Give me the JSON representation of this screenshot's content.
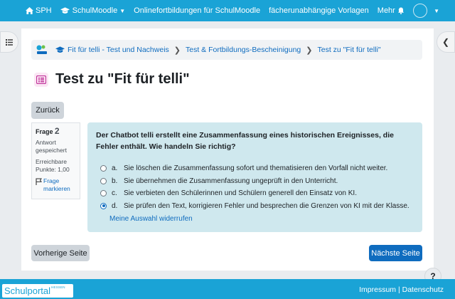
{
  "topnav": {
    "home_label": "SPH",
    "items": [
      "SchulMoodle",
      "Onlinefortbildungen für SchulMoodle",
      "fächerunabhängige Vorlagen",
      "Mehr"
    ]
  },
  "breadcrumb": [
    "Fit für telli - Test und Nachweis",
    "Test & Fortbildungs-Bescheinigung",
    "Test zu \"Fit für telli\""
  ],
  "page_title": "Test zu \"Fit für telli\"",
  "back_label": "Zurück",
  "question_info": {
    "label": "Frage",
    "number": "2",
    "state": "Antwort gespeichert",
    "points": "Erreichbare Punkte: 1,00",
    "flag": "Frage markieren"
  },
  "question": {
    "text": "Der Chatbot telli erstellt eine Zusammenfassung eines historischen Ereignisses, die Fehler enthält. Wie handeln Sie richtig?",
    "answers": [
      {
        "letter": "a.",
        "text": "Sie löschen die Zusammenfassung sofort und thematisieren den Vorfall nicht weiter.",
        "selected": false
      },
      {
        "letter": "b.",
        "text": "Sie übernehmen die Zusammenfassung ungeprüft in den Unterricht.",
        "selected": false
      },
      {
        "letter": "c.",
        "text": "Sie verbieten den Schülerinnen und Schülern generell den Einsatz von KI.",
        "selected": false
      },
      {
        "letter": "d.",
        "text": "Sie prüfen den Text, korrigieren Fehler und besprechen die Grenzen von KI mit der Klasse.",
        "selected": true
      }
    ],
    "clear_label": "Meine Auswahl widerrufen"
  },
  "prev_label": "Vorherige Seite",
  "next_label": "Nächste Seite",
  "footer": {
    "logo_text": "Schulportal",
    "logo_sub": "HESSEN",
    "impressum": "Impressum",
    "separator": "|",
    "datenschutz": "Datenschutz"
  },
  "help_label": "?",
  "colors": {
    "brand": "#1aa3d6",
    "primary": "#0f6cbf",
    "question_bg": "#cfe8ee"
  }
}
